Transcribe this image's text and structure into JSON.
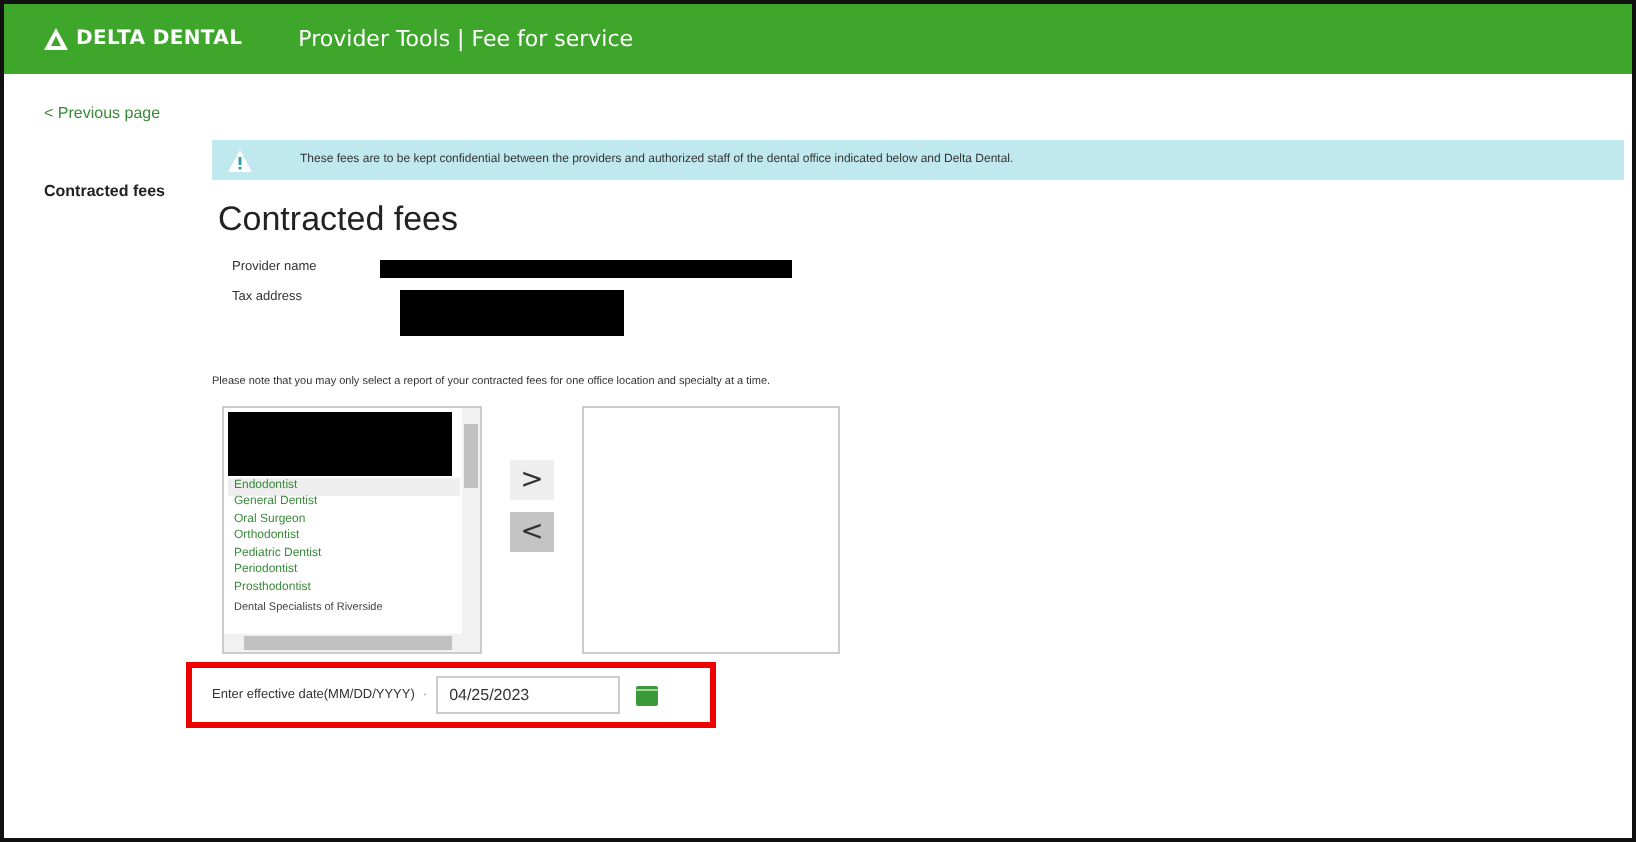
{
  "header": {
    "logo": "DELTA DENTAL",
    "title": "Provider Tools | Fee for service"
  },
  "sidebar": {
    "back_link": "< Previous page",
    "items": [
      {
        "label": "Contracted fees",
        "selected": true
      }
    ]
  },
  "alert": {
    "text": "These fees are to be kept confidential between the providers and authorized staff of the dental office indicated below and Delta Dental."
  },
  "heading": "Contracted fees",
  "fields": [
    {
      "label": "Provider name"
    },
    {
      "label": "Tax address"
    }
  ],
  "note": "Please note that you may only select a report of your contracted fees for one office location and specialty at a time.",
  "specialties": [
    {
      "label": "Endodontist",
      "selected": true
    },
    {
      "label": "General Dentist",
      "selected": false
    },
    {
      "label": "Oral Surgeon",
      "selected": false
    },
    {
      "label": "Orthodontist",
      "selected": false
    },
    {
      "label": "Pediatric Dentist",
      "selected": false
    },
    {
      "label": "Periodontist",
      "selected": false
    },
    {
      "label": "Prosthodontist",
      "selected": false
    }
  ],
  "next_group": "Dental Specialists of Riverside",
  "move_buttons": [
    {
      "label": ">",
      "disabled": false
    },
    {
      "label": "<",
      "disabled": true
    }
  ],
  "date": {
    "label": "Enter effective date(MM/DD/YYYY)",
    "required_mark": "·",
    "value": "04/25/2023"
  }
}
